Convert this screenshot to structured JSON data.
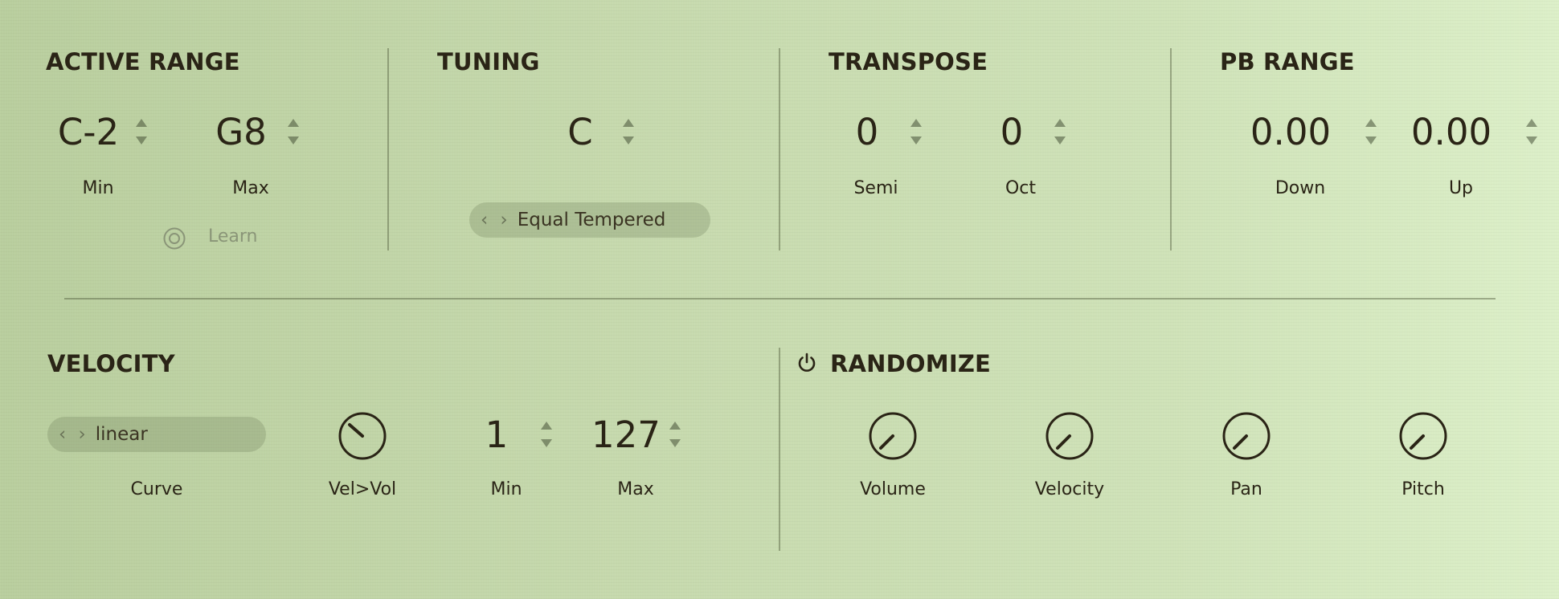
{
  "active_range": {
    "title": "ACTIVE RANGE",
    "min_value": "C-2",
    "max_value": "G8",
    "min_label": "Min",
    "max_label": "Max",
    "learn_label": "Learn"
  },
  "tuning": {
    "title": "TUNING",
    "key_value": "C",
    "scale_value": "Equal Tempered",
    "nav_arrows": "‹ ›"
  },
  "transpose": {
    "title": "TRANSPOSE",
    "semi_value": "0",
    "oct_value": "0",
    "semi_label": "Semi",
    "oct_label": "Oct"
  },
  "pb_range": {
    "title": "PB RANGE",
    "down_value": "0.00",
    "up_value": "0.00",
    "down_label": "Down",
    "up_label": "Up"
  },
  "velocity": {
    "title": "VELOCITY",
    "curve_value": "linear",
    "curve_label": "Curve",
    "velvol_label": "Vel>Vol",
    "min_value": "1",
    "max_value": "127",
    "min_label": "Min",
    "max_label": "Max",
    "nav_arrows": "‹ ›"
  },
  "randomize": {
    "title": "RANDOMIZE",
    "knobs": [
      {
        "label": "Volume",
        "icon": "knob-icon"
      },
      {
        "label": "Velocity",
        "icon": "knob-icon"
      },
      {
        "label": "Pan",
        "icon": "knob-icon"
      },
      {
        "label": "Pitch",
        "icon": "knob-icon"
      }
    ]
  },
  "icons": {
    "spinner": "up-down-arrows-icon",
    "learn": "target-icon",
    "power": "power-icon"
  },
  "colors": {
    "text": "#2a2416",
    "muted": "#8a9578",
    "pill_bg": "#a7b68e"
  }
}
